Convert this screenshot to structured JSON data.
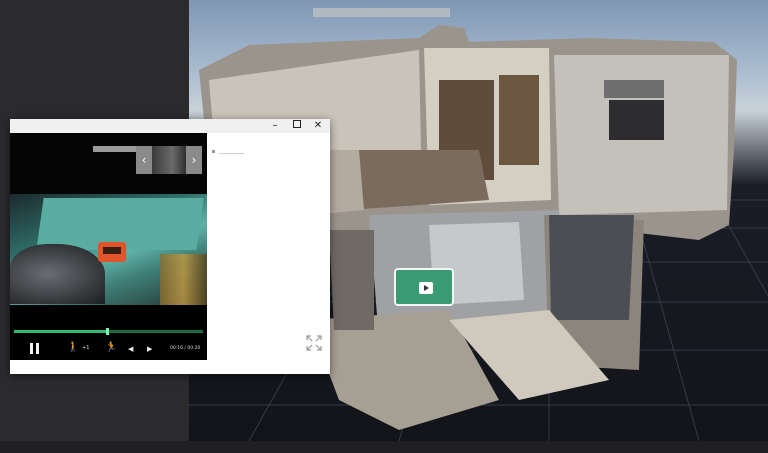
{
  "viewer": {
    "icons": {
      "play": "play-icon",
      "expand": "expand-icon"
    }
  },
  "window": {
    "buttons": {
      "minimize": "–",
      "close": "✕"
    }
  },
  "gallery": {
    "prev": "‹",
    "next": "›"
  },
  "player": {
    "speed": "+1",
    "time": "00:16 / 00:20",
    "progress": 0.49,
    "colors": {
      "progress": "#2fbd73",
      "track": "#1e6a44"
    },
    "icons": {
      "walk": "🚶",
      "run": "🏃",
      "rewind": "◀",
      "forward": "▶"
    }
  }
}
